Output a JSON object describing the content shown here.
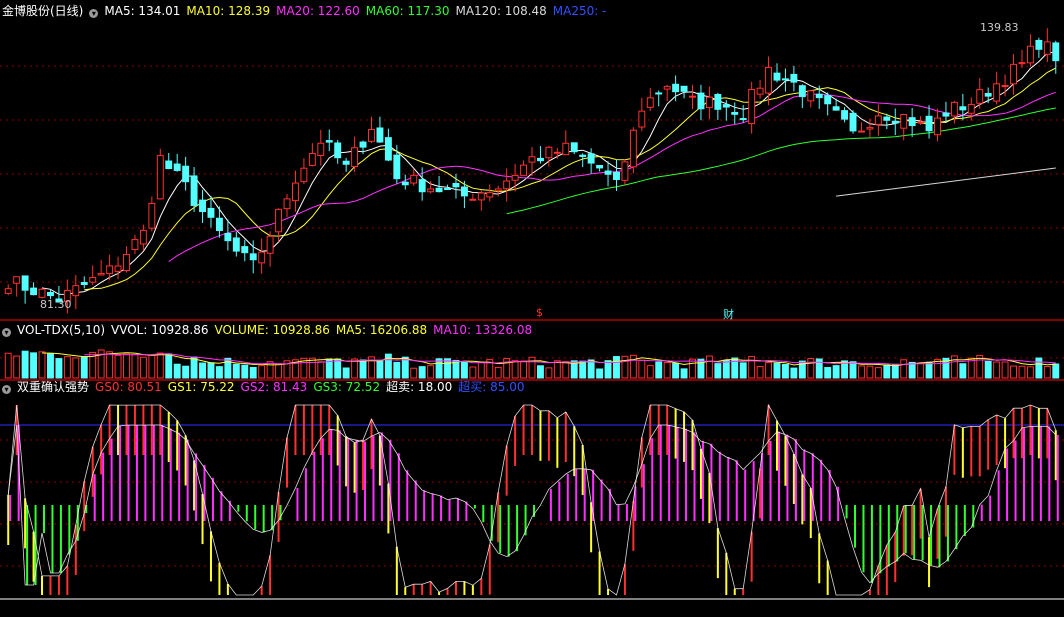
{
  "colors": {
    "up": "#ff3030",
    "down": "#54ffff",
    "ma5": "#ffffff",
    "ma10": "#ffff30",
    "ma20": "#ff30ff",
    "ma60": "#30ff30",
    "ma120": "#d8d8d8",
    "ma250": "#3030ff",
    "grid": "#8b0000",
    "border": "#b00000"
  },
  "price_panel": {
    "title": "金博股份(日线)",
    "ma5": "MA5: 134.01",
    "ma10": "MA10: 128.39",
    "ma20": "MA20: 122.60",
    "ma60": "MA60: 117.30",
    "ma120": "MA120: 108.48",
    "ma250": "MA250: -",
    "high_label": "139.83",
    "low_label": "81.30",
    "event_markers": [
      "$",
      "财"
    ]
  },
  "vol_panel": {
    "title": "VOL-TDX(5,10)",
    "vvol": "VVOL: 10928.86",
    "volume": "VOLUME: 10928.86",
    "ma5": "MA5: 16206.88",
    "ma10": "MA10: 13326.08"
  },
  "ind_panel": {
    "title": "双重确认强势",
    "gs0": "GS0: 80.51",
    "gs1": "GS1: 75.22",
    "gs2": "GS2: 81.43",
    "gs3": "GS3: 72.52",
    "oversold": "超卖: 18.00",
    "overbought": "超买: 85.00"
  },
  "chart_data": {
    "type": "candlestick",
    "bars": 125,
    "price_ylim": [
      78,
      142
    ],
    "high": 139.83,
    "low": 81.3,
    "close_anchors": [
      [
        0,
        86
      ],
      [
        3,
        84
      ],
      [
        6,
        82
      ],
      [
        9,
        85
      ],
      [
        12,
        88
      ],
      [
        16,
        96
      ],
      [
        18,
        112
      ],
      [
        21,
        106
      ],
      [
        24,
        98
      ],
      [
        27,
        92
      ],
      [
        29,
        89
      ],
      [
        31,
        96
      ],
      [
        34,
        108
      ],
      [
        37,
        116
      ],
      [
        40,
        110
      ],
      [
        43,
        119
      ],
      [
        46,
        108
      ],
      [
        50,
        106
      ],
      [
        54,
        104
      ],
      [
        58,
        106
      ],
      [
        62,
        112
      ],
      [
        66,
        114
      ],
      [
        70,
        110
      ],
      [
        72,
        106
      ],
      [
        75,
        123
      ],
      [
        78,
        128
      ],
      [
        81,
        124
      ],
      [
        84,
        124
      ],
      [
        87,
        122
      ],
      [
        90,
        131
      ],
      [
        93,
        128
      ],
      [
        95,
        125
      ],
      [
        98,
        121
      ],
      [
        100,
        117
      ],
      [
        103,
        122
      ],
      [
        106,
        121
      ],
      [
        109,
        118
      ],
      [
        111,
        122
      ],
      [
        114,
        124
      ],
      [
        117,
        128
      ],
      [
        120,
        132
      ],
      [
        122,
        137
      ],
      [
        124,
        134
      ]
    ],
    "volume_ylim": [
      0,
      45000
    ],
    "indicator_ylim": [
      -5,
      100
    ],
    "indicator_levels": {
      "oversold": 18,
      "overbought": 85
    }
  }
}
